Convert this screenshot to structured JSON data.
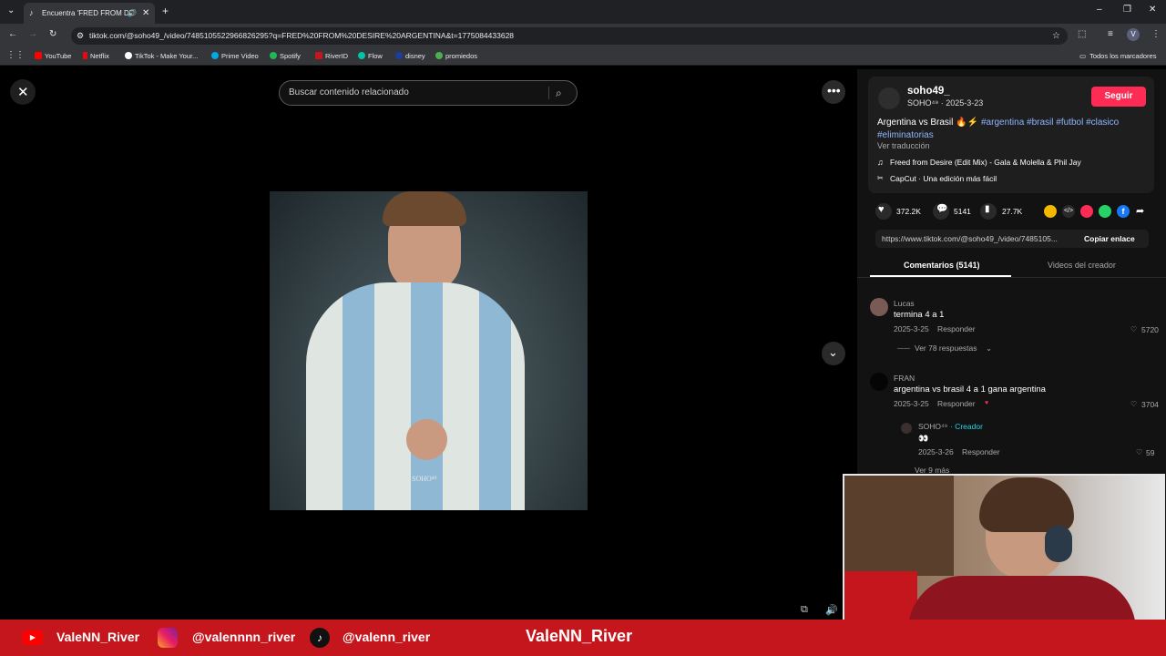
{
  "browser": {
    "tab_title": "Encuentra 'FRED FROM DE",
    "url": "tiktok.com/@soho49_/video/7485105522966826295?q=FRED%20FROM%20DESIRE%20ARGENTINA&t=1775084433628",
    "profile_initial": "V",
    "bookmarks": [
      "YouTube",
      "Netflix",
      "TikTok - Make Your...",
      "Prime Video",
      "Spotify",
      "RiverID",
      "Flow",
      "disney",
      "promiedos"
    ],
    "all_bookmarks": "Todos los marcadores",
    "bookmark_colors": [
      "#ff0000",
      "#e50914",
      "#ffffff",
      "#00a8e1",
      "#1db954",
      "#c4161c",
      "#00c2a8",
      "#1a3e9e",
      "#4caf50"
    ]
  },
  "video": {
    "search_placeholder": "Buscar contenido relacionado",
    "watermark": "SOHO⁴⁹"
  },
  "post": {
    "username": "soho49_",
    "subline": "SOHO⁴⁹ · 2025-3-23",
    "follow_label": "Seguir",
    "caption_prefix": "Argentina vs Brasil 🔥⚡",
    "hashtags_line1": "#argentina #brasil #futbol #clasico",
    "hashtags_line2": "#eliminatorias",
    "translate": "Ver traducción",
    "music": "Freed from Desire (Edit Mix) - Gala & Molella & Phil Jay",
    "capcut": "CapCut · Una edición más fácil",
    "likes": "372.2K",
    "comments": "5141",
    "saves": "27.7K",
    "link_url": "https://www.tiktok.com/@soho49_/video/7485105...",
    "copy_link": "Copiar enlace"
  },
  "tabs": {
    "comments": "Comentarios (5141)",
    "creator_videos": "Videos del creador"
  },
  "comments": [
    {
      "author": "Lucas",
      "text": "termina 4 a 1",
      "date": "2025-3-25",
      "reply": "Responder",
      "likes": "5720",
      "view_replies": "Ver 78 respuestas"
    },
    {
      "author": "FRAN",
      "text": "argentina vs brasil 4 a 1 gana argentina",
      "date": "2025-3-25",
      "reply": "Responder",
      "likes": "3704"
    }
  ],
  "reply": {
    "author": "SOHO⁴⁹",
    "creator_tag": "· Creador",
    "text": "👀",
    "date": "2025-3-26",
    "reply": "Responder",
    "likes": "59",
    "view_more": "Ver 9 más"
  },
  "banner": {
    "youtube": "ValeNN_River",
    "instagram": "@valennnn_river",
    "tiktok": "@valenn_river",
    "center": "ValeNN_River"
  },
  "colors": {
    "follow": "#fe2c55",
    "banner": "#c4161c",
    "hashtag": "#8fb5ff",
    "creator": "#20d5ec"
  }
}
